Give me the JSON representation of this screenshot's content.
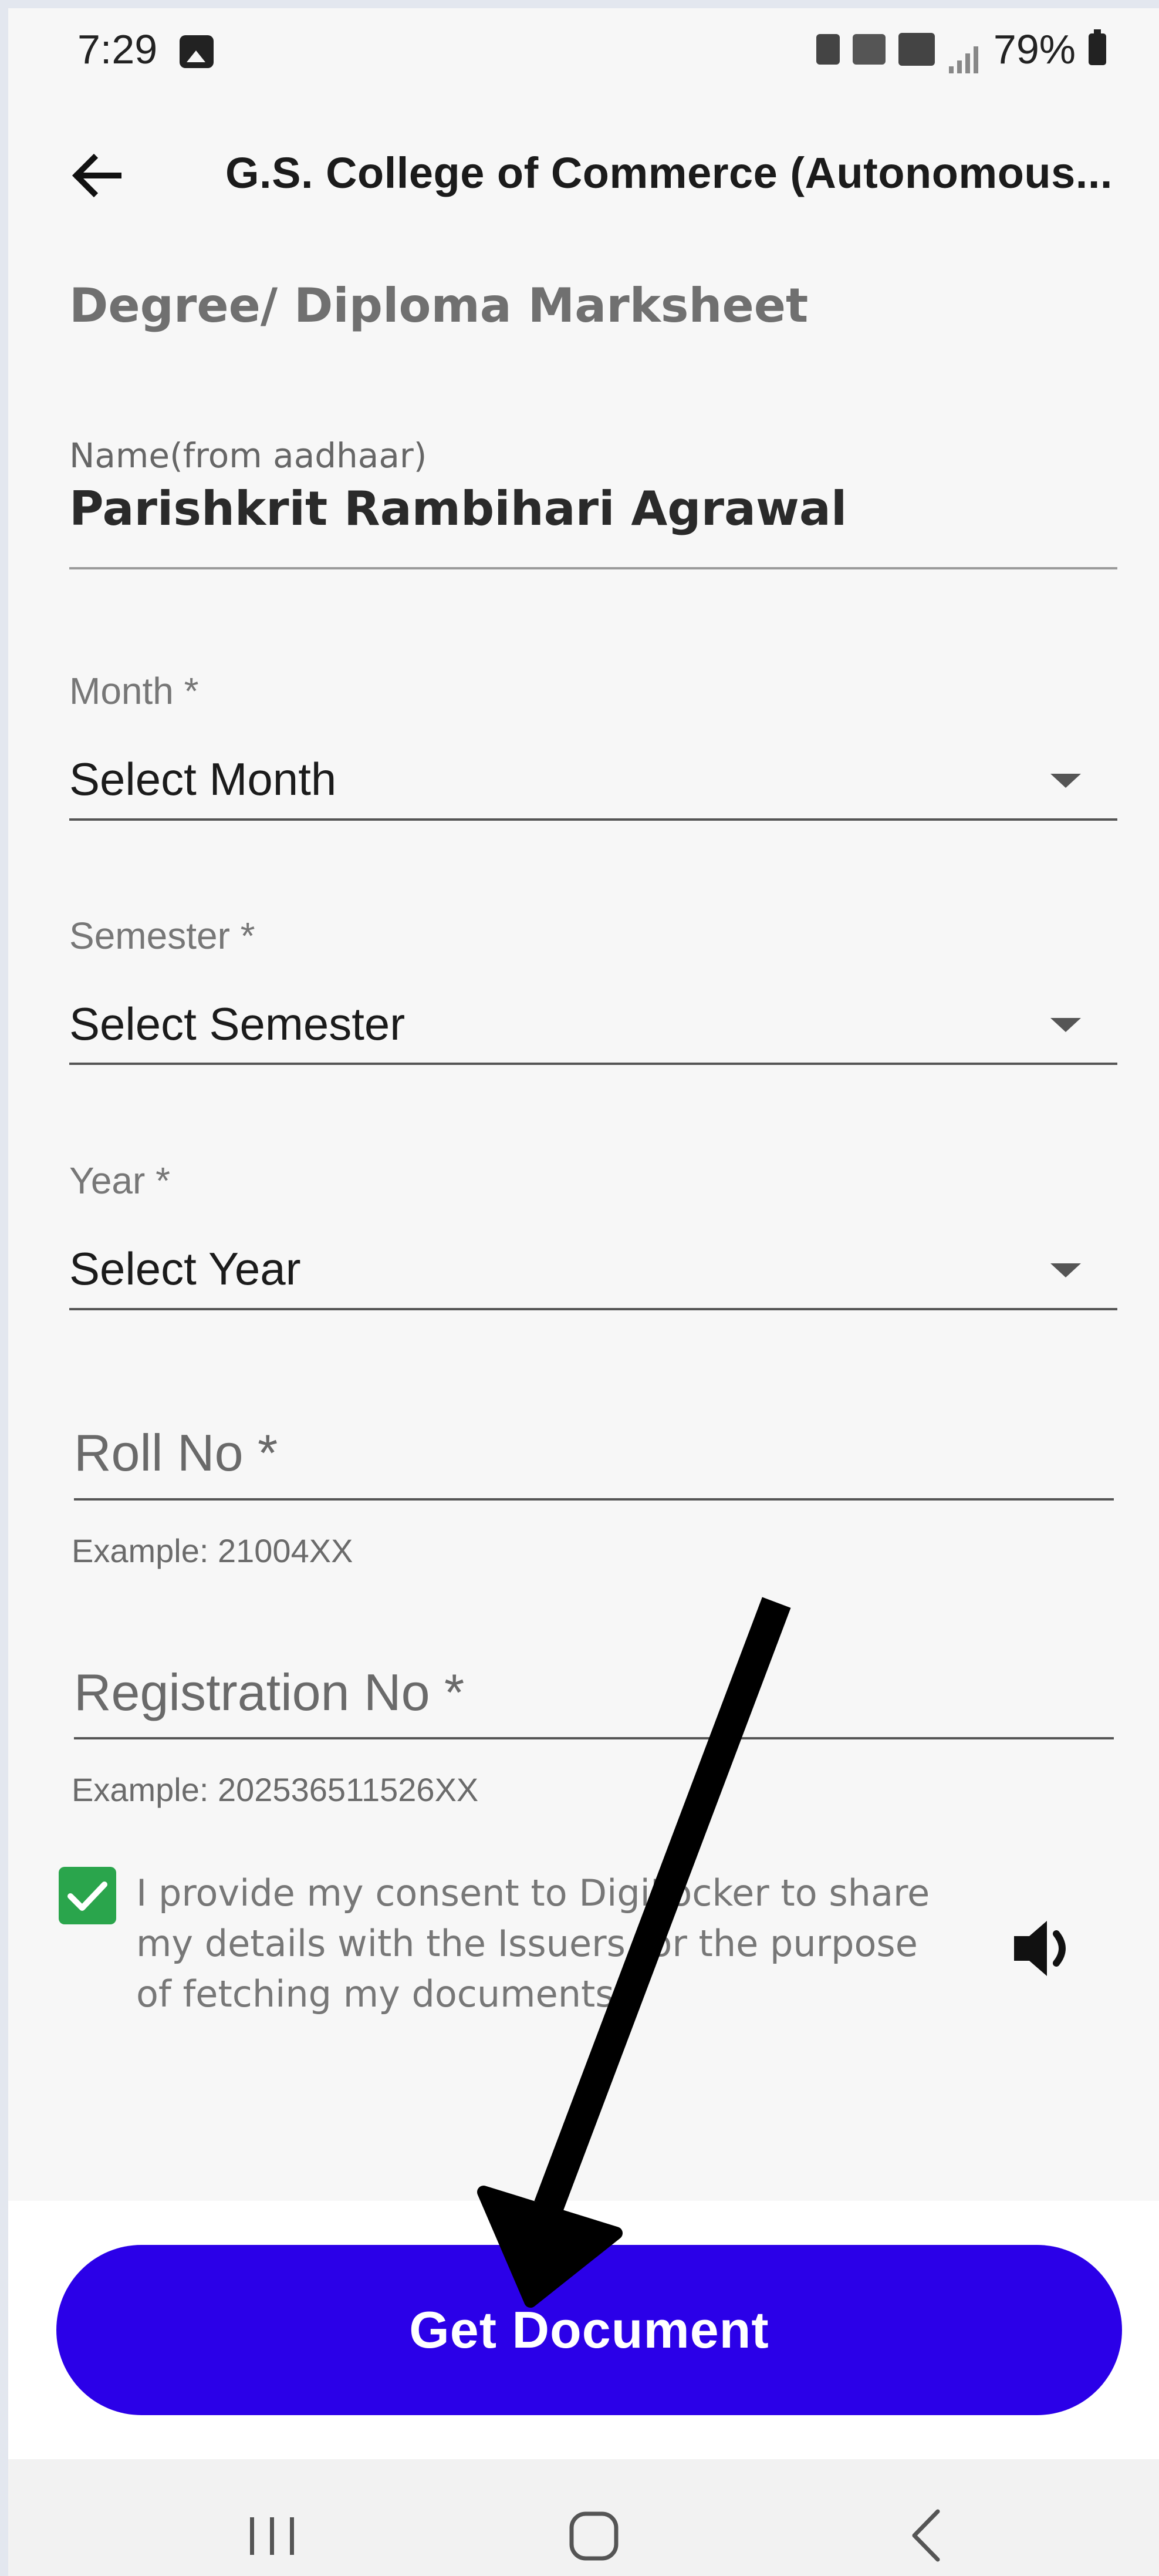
{
  "status_bar": {
    "time": "7:29",
    "battery": "79%"
  },
  "app_bar": {
    "title": "G.S. College of Commerce (Autonomous..."
  },
  "form": {
    "section_title": "Degree/ Diploma Marksheet",
    "name_caption": "Name(from aadhaar)",
    "name_value": "Parishkrit Rambihari Agrawal",
    "month_label": "Month *",
    "month_value": "Select Month",
    "semester_label": "Semester *",
    "semester_value": "Select Semester",
    "year_label": "Year *",
    "year_value": "Select Year",
    "roll_placeholder": "Roll No *",
    "roll_helper": "Example: 21004XX",
    "reg_placeholder": "Registration No *",
    "reg_helper": "Example: 202536511526XX",
    "consent_checked": true,
    "consent_text": "I provide my consent to DigiLocker to share my details with the Issuers for the purpose of fetching my documents."
  },
  "actions": {
    "get_document": "Get Document"
  },
  "icons": {
    "back": "back-arrow-icon",
    "speaker": "speaker-icon",
    "dropdown": "chevron-down-icon"
  },
  "colors": {
    "primary": "#2b00e8",
    "checkbox": "#2aa54c"
  }
}
